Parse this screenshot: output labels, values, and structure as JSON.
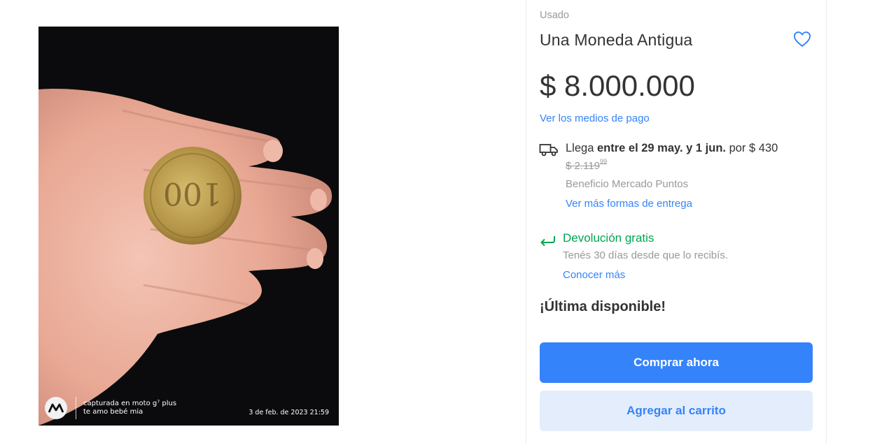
{
  "photo": {
    "watermark_line1": "capturada en moto g⁷ plus",
    "watermark_line2": "te amo bebé mia",
    "date_stamp": "3 de feb. de 2023 21:59",
    "alt": "Una Moneda Antigua"
  },
  "product": {
    "condition": "Usado",
    "title": "Una Moneda Antigua",
    "price": "$ 8.000.000",
    "payment_link": "Ver los medios de pago"
  },
  "shipping": {
    "prefix": "Llega ",
    "bold_text": "entre el 29 may. y 1 jun.",
    "suffix": " por $ 430",
    "old_price": "$ 2.119",
    "old_price_cents": "99",
    "benefit": "Beneficio Mercado Puntos",
    "more_link": "Ver más formas de entrega"
  },
  "returns": {
    "title": "Devolución gratis",
    "subtitle": "Tenés 30 días desde que lo recibís.",
    "link": "Conocer más"
  },
  "stock": "¡Última disponible!",
  "buttons": {
    "buy": "Comprar ahora",
    "cart": "Agregar al carrito"
  },
  "colors": {
    "accent": "#3483fa",
    "success": "#00a650",
    "secondary_button_bg": "#e3edfb"
  },
  "icons": [
    "heart-icon",
    "truck-icon",
    "return-arrow-icon",
    "motorola-logo"
  ]
}
